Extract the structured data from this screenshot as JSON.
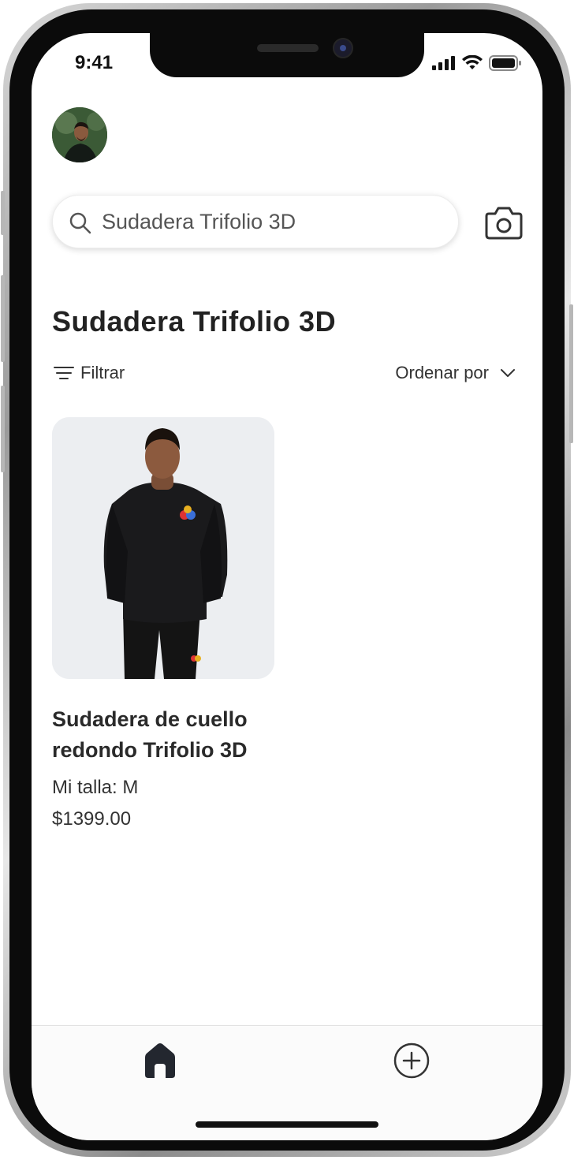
{
  "status_bar": {
    "time": "9:41",
    "icons": [
      "cellular-signal-icon",
      "wifi-icon",
      "battery-icon"
    ]
  },
  "profile": {
    "avatar": "user-avatar"
  },
  "search": {
    "value": "Sudadera Trifolio 3D",
    "icon": "search-icon",
    "camera_icon": "camera-icon"
  },
  "results": {
    "title": "Sudadera Trifolio 3D",
    "filter_label": "Filtrar",
    "sort_label": "Ordenar por"
  },
  "products": [
    {
      "name": "Sudadera de cuello redondo Trifolio 3D",
      "size": "Mi talla: M",
      "price": "$1399.00"
    }
  ],
  "tab_bar": {
    "items": [
      "home-icon",
      "add-circle-icon"
    ]
  },
  "colors": {
    "text": "#222222",
    "card_bg": "#eceef1",
    "device_frame": "#0b0b0b"
  }
}
